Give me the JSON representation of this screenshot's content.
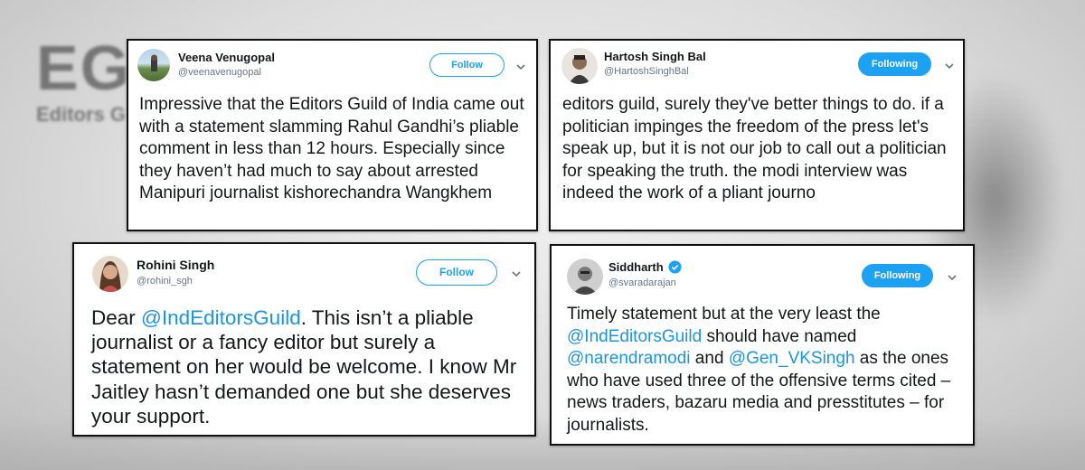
{
  "background": {
    "logo_big": "EGI",
    "logo_small": "Editors G"
  },
  "colors": {
    "accent": "#1da1f2",
    "mention": "#1b95e0",
    "text": "#14171a",
    "handle": "#657786"
  },
  "tweets": [
    {
      "name": "Veena Venugopal",
      "handle": "@veenavenugopal",
      "button": "Follow",
      "verified": false,
      "text": "Impressive that the Editors Guild of India came out with a statement slamming Rahul Gandhi’s pliable comment in less than 12 hours. Especially since they haven’t had much to say about arrested Manipuri journalist kishorechandra Wangkhem"
    },
    {
      "name": "Hartosh Singh Bal",
      "handle": "@HartoshSinghBal",
      "button": "Following",
      "verified": false,
      "text": "editors guild, surely they've better things to do. if a politician impinges the freedom of the press let's speak up, but it is not our job to call out a politician for speaking the truth. the modi interview was indeed the work of a pliant journo"
    },
    {
      "name": "Rohini Singh",
      "handle": "@rohini_sgh",
      "button": "Follow",
      "verified": false,
      "text_parts": [
        "Dear ",
        "@IndEditorsGuild",
        ". This isn’t a pliable journalist or a fancy editor but surely a statement on her would be welcome. I know Mr Jaitley hasn’t demanded one but she deserves your support."
      ]
    },
    {
      "name": "Siddharth",
      "handle": "@svaradarajan",
      "button": "Following",
      "verified": true,
      "text_parts": [
        "Timely statement but at the very least the ",
        "@IndEditorsGuild",
        " should have named ",
        "@narendramodi",
        " and ",
        "@Gen_VKSingh",
        " as the ones who have used three of the offensive terms cited – news traders, bazaru media and presstitutes – for journalists."
      ]
    }
  ]
}
